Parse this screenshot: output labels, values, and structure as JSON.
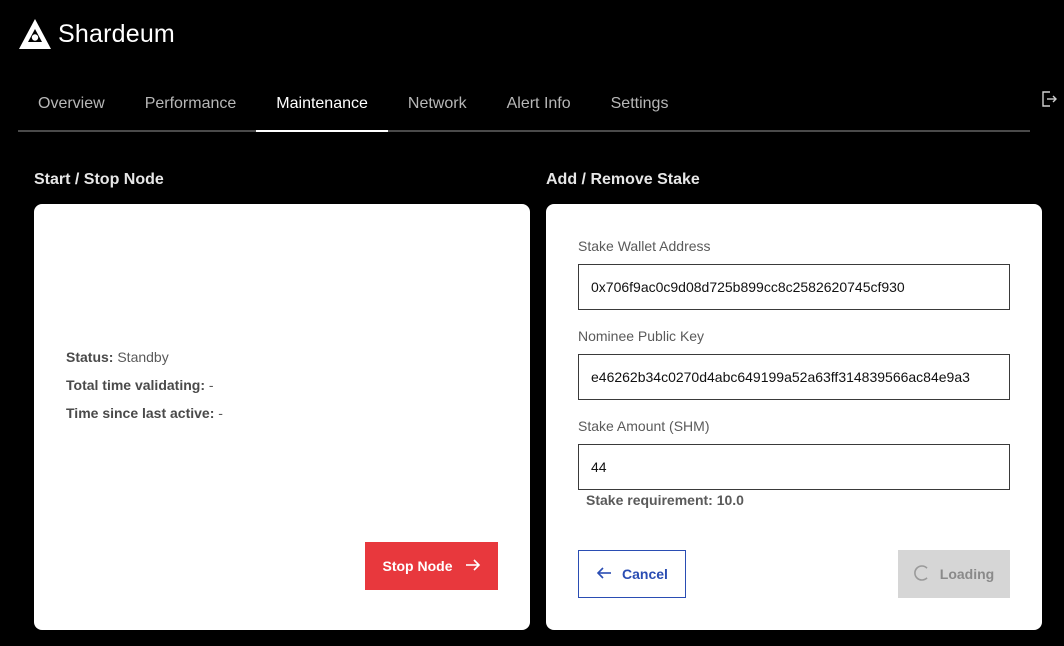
{
  "brand": {
    "name": "Shardeum",
    "logo_icon": "shardeum-logo-icon"
  },
  "nav": {
    "tabs": [
      {
        "label": "Overview",
        "active": false
      },
      {
        "label": "Performance",
        "active": false
      },
      {
        "label": "Maintenance",
        "active": true
      },
      {
        "label": "Network",
        "active": false
      },
      {
        "label": "Alert Info",
        "active": false
      },
      {
        "label": "Settings",
        "active": false
      }
    ],
    "logout_icon": "logout-icon"
  },
  "node": {
    "section_title": "Start / Stop Node",
    "status_label": "Status:",
    "status_value": "Standby",
    "total_time_label": "Total time validating:",
    "total_time_value": "-",
    "last_active_label": "Time since last active:",
    "last_active_value": "-",
    "stop_button_label": "Stop Node",
    "stop_button_icon": "arrow-right-icon",
    "stop_button_color": "#e8383d"
  },
  "stake": {
    "section_title": "Add / Remove Stake",
    "wallet_label": "Stake Wallet Address",
    "wallet_value": "0x706f9ac0c9d08d725b899cc8c2582620745cf930",
    "nominee_label": "Nominee Public Key",
    "nominee_value": "e46262b34c0270d4abc649199a52a63ff314839566ac84e9a3",
    "amount_label": "Stake Amount (SHM)",
    "amount_value": "44",
    "requirement_text": "Stake requirement: 10.0",
    "cancel_label": "Cancel",
    "cancel_icon": "arrow-left-icon",
    "loading_label": "Loading",
    "loading_icon": "spinner-icon",
    "accent_color": "#2a4db3"
  }
}
